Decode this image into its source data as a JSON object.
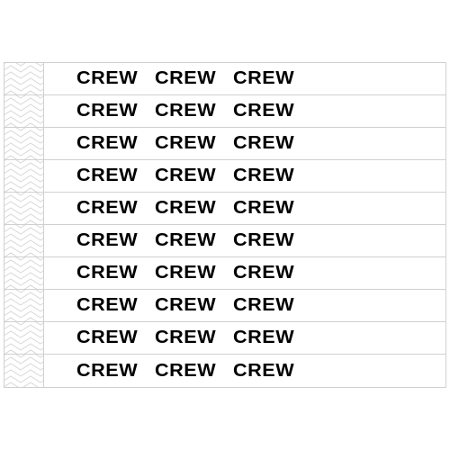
{
  "band_count": 10,
  "word": "CREW",
  "repeats_per_band": 3,
  "colors": {
    "border": "#d0d0d0",
    "text": "#000000",
    "chevron": "#d8d8d8",
    "background": "#ffffff"
  }
}
